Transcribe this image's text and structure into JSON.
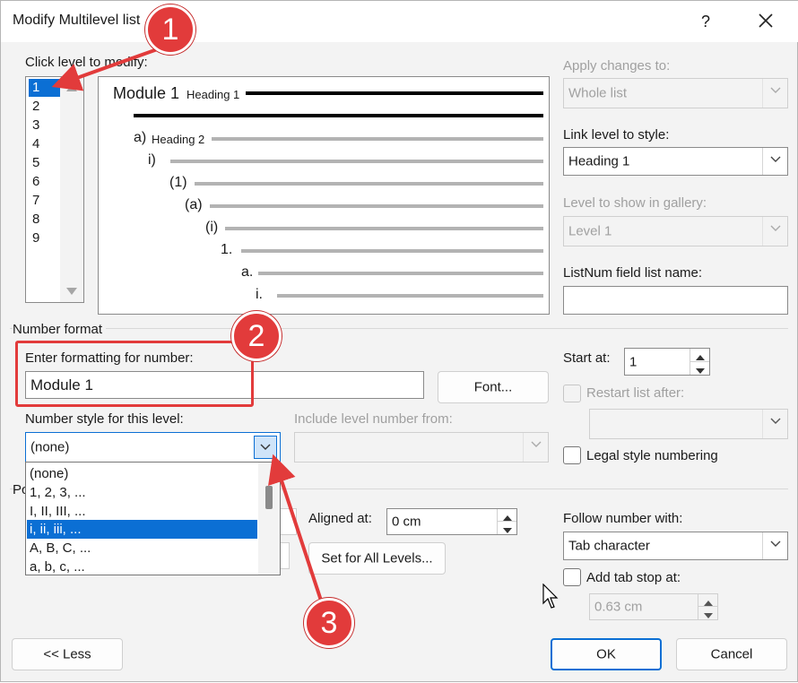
{
  "window": {
    "title": "Modify Multilevel list",
    "help": "?",
    "close": "✕"
  },
  "levels": {
    "label": "Click level to modify:",
    "items": [
      "1",
      "2",
      "3",
      "4",
      "5",
      "6",
      "7",
      "8",
      "9"
    ],
    "selected": "1"
  },
  "preview": {
    "lines": [
      {
        "num": "Module 1",
        "style": "Heading 1"
      },
      {
        "num": "a)",
        "style": "Heading 2"
      },
      {
        "num": "i)"
      },
      {
        "num": "(1)"
      },
      {
        "num": "(a)"
      },
      {
        "num": "(i)"
      },
      {
        "num": "1."
      },
      {
        "num": "a."
      },
      {
        "num": "i."
      }
    ]
  },
  "right_panel": {
    "apply_label": "Apply changes to:",
    "apply_value": "Whole list",
    "link_label": "Link level to style:",
    "link_value": "Heading 1",
    "gallery_label": "Level to show in gallery:",
    "gallery_value": "Level 1",
    "listnum_label": "ListNum field list name:",
    "listnum_value": ""
  },
  "number_format": {
    "section_label": "Number format",
    "enter_label": "Enter formatting for number:",
    "enter_value": "Module 1",
    "font_button": "Font...",
    "style_label": "Number style for this level:",
    "style_value": "(none)",
    "include_label": "Include level number from:",
    "include_value": "",
    "start_label": "Start at:",
    "start_value": "1",
    "restart_label": "Restart list after:",
    "legal_label": "Legal style numbering",
    "dropdown_options": [
      "(none)",
      "1, 2, 3, ...",
      "I, II, III, ...",
      "i, ii, iii, ...",
      "A, B, C, ...",
      "a, b, c, ..."
    ],
    "dropdown_selected": "i, ii, iii, ..."
  },
  "position": {
    "section_label": "Po",
    "aligned_label": "Aligned at:",
    "aligned_value": "0 cm",
    "set_all_button": "Set for All Levels...",
    "follow_label": "Follow number with:",
    "follow_value": "Tab character",
    "tabstop_label": "Add tab stop at:",
    "tabstop_value": "0.63 cm"
  },
  "footer": {
    "less_button": "<< Less",
    "ok_button": "OK",
    "cancel_button": "Cancel"
  },
  "callouts": [
    "1",
    "2",
    "3"
  ],
  "colors": {
    "accent": "#0b6fd4",
    "callout": "#e23b3b"
  }
}
